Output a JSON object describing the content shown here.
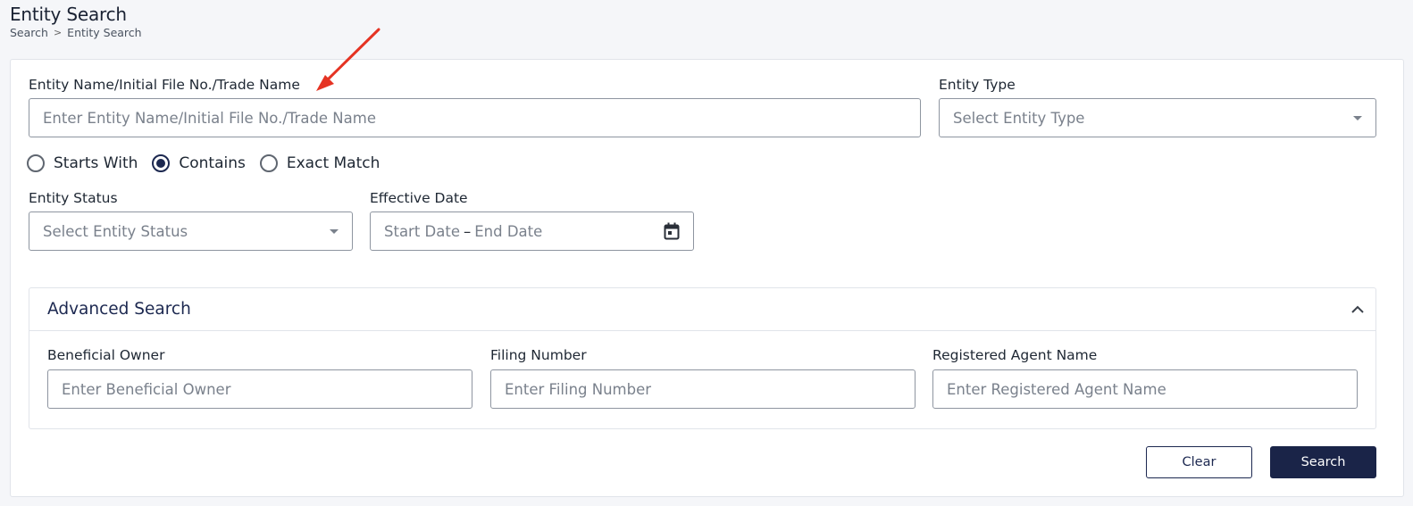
{
  "header": {
    "title": "Entity Search",
    "breadcrumb": [
      "Search",
      "Entity Search"
    ],
    "breadcrumb_separator": ">"
  },
  "form": {
    "entity_name": {
      "label": "Entity Name/Initial File No./Trade Name",
      "placeholder": "Enter Entity Name/Initial File No./Trade Name",
      "value": ""
    },
    "entity_type": {
      "label": "Entity Type",
      "placeholder": "Select Entity Type"
    },
    "match_options": [
      {
        "label": "Starts With",
        "checked": false
      },
      {
        "label": "Contains",
        "checked": true
      },
      {
        "label": "Exact Match",
        "checked": false
      }
    ],
    "entity_status": {
      "label": "Entity Status",
      "placeholder": "Select Entity Status"
    },
    "effective_date": {
      "label": "Effective Date",
      "start_placeholder": "Start Date",
      "separator": "–",
      "end_placeholder": "End Date"
    }
  },
  "advanced": {
    "title": "Advanced Search",
    "expanded": true,
    "fields": [
      {
        "label": "Beneficial Owner",
        "placeholder": "Enter Beneficial Owner",
        "value": ""
      },
      {
        "label": "Filing Number",
        "placeholder": "Enter Filing Number",
        "value": ""
      },
      {
        "label": "Registered Agent Name",
        "placeholder": "Enter Registered Agent Name",
        "value": ""
      }
    ]
  },
  "actions": {
    "clear_label": "Clear",
    "search_label": "Search"
  },
  "colors": {
    "primary": "#1a2448",
    "annotation_arrow": "#e53323"
  },
  "icons": {
    "dropdown": "caret-down-icon",
    "date": "calendar-icon",
    "collapse": "chevron-up-icon",
    "annotation": "red-arrow-icon"
  }
}
